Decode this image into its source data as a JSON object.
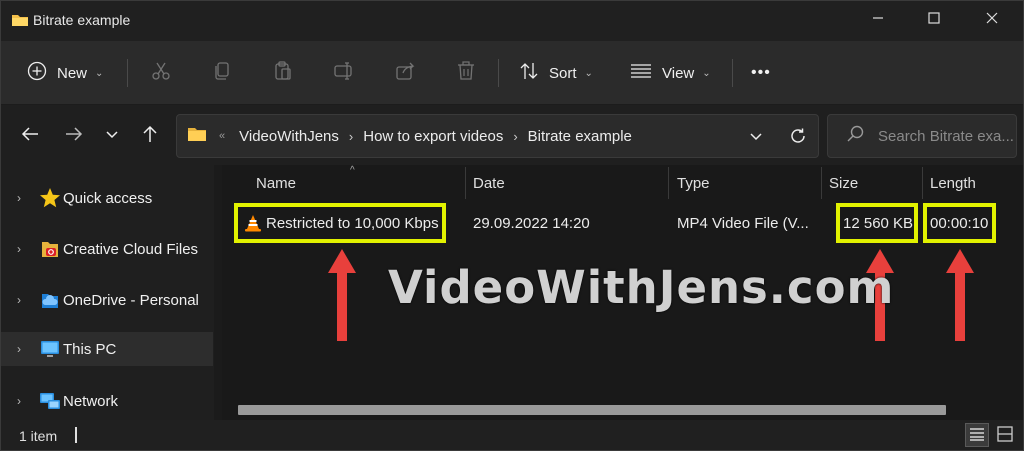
{
  "window": {
    "title": "Bitrate example",
    "controls": [
      "minimize-icon",
      "maximize-icon",
      "close-icon"
    ]
  },
  "toolbar": {
    "new_label": "New",
    "sort_label": "Sort",
    "view_label": "View",
    "more_label": "•••",
    "icons": [
      "cut-icon",
      "copy-icon",
      "paste-icon",
      "rename-icon",
      "share-icon",
      "delete-icon"
    ]
  },
  "address": {
    "overflow": "«",
    "crumbs": [
      "VideoWithJens",
      "How to export videos",
      "Bitrate example"
    ],
    "separator": "›"
  },
  "search": {
    "placeholder": "Search Bitrate exa..."
  },
  "sidebar": {
    "items": [
      {
        "label": "Quick access",
        "icon": "star-icon"
      },
      {
        "label": "Creative Cloud Files",
        "icon": "creative-cloud-folder-icon"
      },
      {
        "label": "OneDrive - Personal",
        "icon": "onedrive-cloud-icon"
      },
      {
        "label": "This PC",
        "icon": "monitor-icon"
      },
      {
        "label": "Network",
        "icon": "network-icon"
      }
    ]
  },
  "columns": {
    "name": "Name",
    "date": "Date",
    "type": "Type",
    "size": "Size",
    "length": "Length"
  },
  "files": [
    {
      "name": "Restricted to 10,000 Kbps",
      "date": "29.09.2022 14:20",
      "type": "MP4 Video File (V...",
      "size": "12 560 KB",
      "length": "00:00:10",
      "icon": "vlc-cone-icon"
    }
  ],
  "overlay": {
    "watermark": "VideoWithJens.com",
    "highlight_color": "#e2f200",
    "arrow_color": "#e8403c"
  },
  "status": {
    "item_count": "1 item"
  }
}
